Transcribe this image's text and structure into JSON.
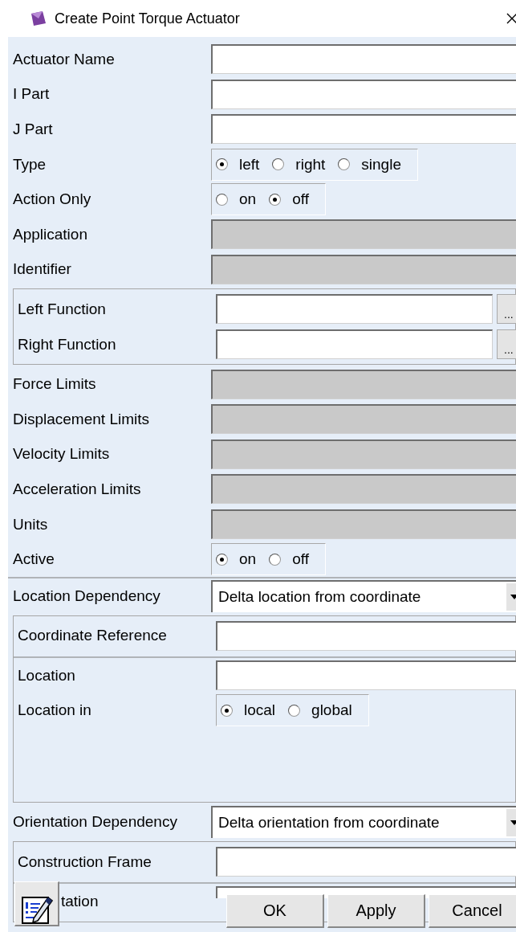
{
  "window": {
    "title": "Create Point Torque Actuator"
  },
  "rows": [
    {
      "kind": "field",
      "label": "Actuator Name"
    },
    {
      "kind": "field",
      "label": "I Part"
    },
    {
      "kind": "field",
      "label": "J Part"
    },
    {
      "kind": "radio",
      "label": "Type",
      "options": [
        {
          "label": "left",
          "selected": true
        },
        {
          "label": "right",
          "selected": false
        },
        {
          "label": "single",
          "selected": false
        }
      ]
    },
    {
      "kind": "radio",
      "label": "Action Only",
      "options": [
        {
          "label": "on",
          "selected": false
        },
        {
          "label": "off",
          "selected": true
        }
      ]
    },
    {
      "kind": "disabled",
      "label": "Application"
    },
    {
      "kind": "disabled",
      "label": "Identifier"
    },
    {
      "kind": "group",
      "rows": [
        {
          "kind": "browse",
          "label": "Left Function",
          "button": "..."
        },
        {
          "kind": "browse",
          "label": "Right Function",
          "button": "..."
        }
      ]
    },
    {
      "kind": "disabled",
      "label": "Force Limits"
    },
    {
      "kind": "disabled",
      "label": "Displacement Limits"
    },
    {
      "kind": "disabled",
      "label": "Velocity Limits"
    },
    {
      "kind": "disabled",
      "label": "Acceleration Limits"
    },
    {
      "kind": "disabled",
      "label": "Units"
    },
    {
      "kind": "radio",
      "label": "Active",
      "options": [
        {
          "label": "on",
          "selected": true
        },
        {
          "label": "off",
          "selected": false
        }
      ]
    },
    {
      "kind": "dropdown",
      "label": "Location Dependency",
      "value": "Delta location from coordinate"
    },
    {
      "kind": "group",
      "rows": [
        {
          "kind": "field",
          "label": "Coordinate Reference"
        },
        {
          "kind": "field",
          "label": "Location"
        },
        {
          "kind": "radio",
          "label": "Location in",
          "options": [
            {
              "label": "local",
              "selected": true
            },
            {
              "label": "global",
              "selected": false
            }
          ]
        }
      ]
    },
    {
      "kind": "dropdown",
      "label": "Orientation Dependency",
      "value": "Delta orientation from coordinate"
    },
    {
      "kind": "group",
      "rows": [
        {
          "kind": "field",
          "label": "Construction Frame"
        },
        {
          "kind": "field",
          "label": "tation"
        }
      ]
    }
  ],
  "buttons": [
    "OK",
    "Apply",
    "Cancel"
  ]
}
